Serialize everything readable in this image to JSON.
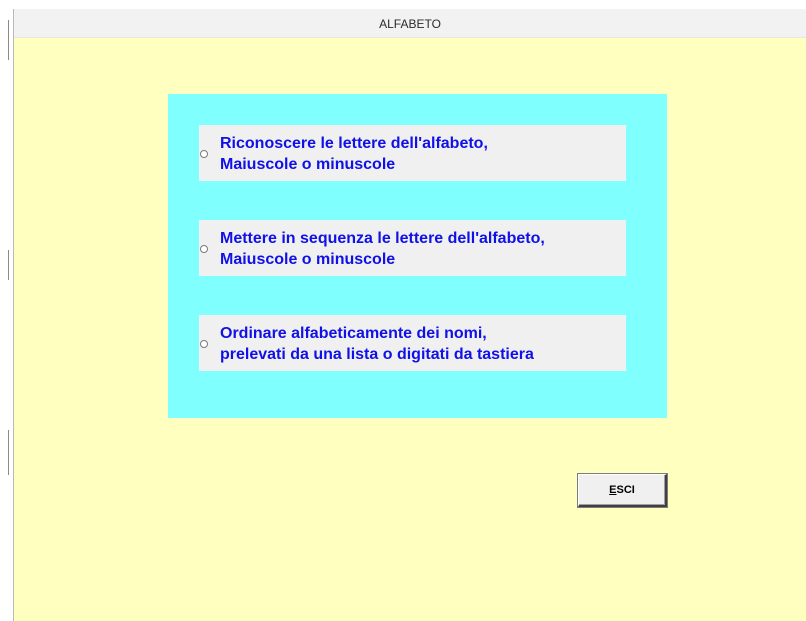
{
  "window": {
    "title": "ALFABETO"
  },
  "options": [
    {
      "line1": "Riconoscere le lettere dell'alfabeto,",
      "line2": "Maiuscole o minuscole"
    },
    {
      "line1": "Mettere in sequenza le lettere dell'alfabeto,",
      "line2": "Maiuscole o minuscole"
    },
    {
      "line1": "Ordinare alfabeticamente dei nomi,",
      "line2": "prelevati da una lista o digitati da tastiera"
    }
  ],
  "exit_button": {
    "mnemonic": "E",
    "rest": "SCI"
  },
  "colors": {
    "background": "#ffffc0",
    "panel": "#80ffff",
    "option_bg": "#f0f0f0",
    "option_text": "#1010e8"
  },
  "icons": [
    "radio-button-icon"
  ]
}
